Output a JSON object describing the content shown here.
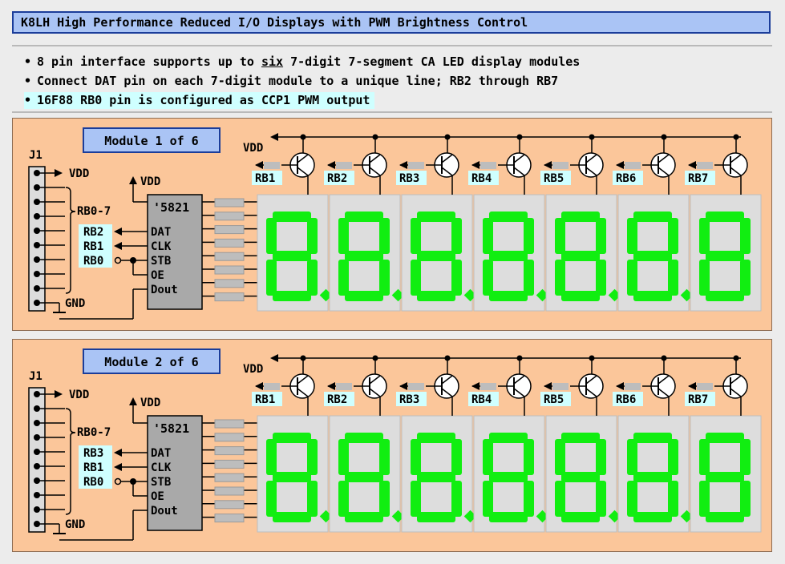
{
  "title": "K8LH High Performance Reduced I/O Displays with PWM Brightness Control",
  "bullets": [
    {
      "pre": "8 pin interface supports up to ",
      "emph": "six",
      "post": " 7-digit 7-segment CA LED display modules"
    },
    {
      "pre": "Connect DAT pin on each 7-digit module to a unique line; RB2 through RB7",
      "emph": "",
      "post": ""
    },
    {
      "pre": "16F88 RB0 pin is configured as CCP1 PWM output",
      "emph": "",
      "post": ""
    }
  ],
  "colors": {
    "segment_on": "#11ee11",
    "module_bg": "#fbc69a",
    "title_bg": "#aac4f5",
    "label_bg": "#cfffff",
    "digit_bg": "#dddddd"
  },
  "modules": [
    {
      "title": "Module 1 of 6",
      "connector": "J1",
      "vdd": "VDD",
      "gnd": "GND",
      "bus_label": "RB0-7",
      "chip_vdd": "VDD",
      "chip_name": "'5821",
      "chip_pins": [
        "DAT",
        "CLK",
        "STB",
        "OE",
        "Dout"
      ],
      "port_labels": [
        "RB2",
        "RB1",
        "RB0"
      ],
      "driver_vdd": "VDD",
      "driver_labels": [
        "RB1",
        "RB2",
        "RB3",
        "RB4",
        "RB5",
        "RB6",
        "RB7"
      ],
      "digits": 7
    },
    {
      "title": "Module 2 of 6",
      "connector": "J1",
      "vdd": "VDD",
      "gnd": "GND",
      "bus_label": "RB0-7",
      "chip_vdd": "VDD",
      "chip_name": "'5821",
      "chip_pins": [
        "DAT",
        "CLK",
        "STB",
        "OE",
        "Dout"
      ],
      "port_labels": [
        "RB3",
        "RB1",
        "RB0"
      ],
      "driver_vdd": "VDD",
      "driver_labels": [
        "RB1",
        "RB2",
        "RB3",
        "RB4",
        "RB5",
        "RB6",
        "RB7"
      ],
      "digits": 7
    }
  ]
}
